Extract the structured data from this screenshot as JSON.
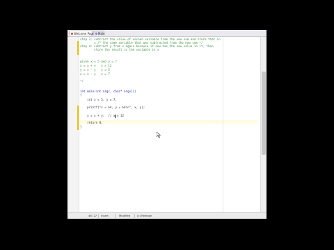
{
  "tabs": [
    {
      "label": "Welcome Page"
    },
    {
      "label": "Main"
    }
  ],
  "code_lines": [
    {
      "text": "step 3: subtract the value of second variable from the new sum and store that in",
      "style": "cmt"
    },
    {
      "text": "        x /* the same variable that was subtracted from the new sum */",
      "style": "cmt"
    },
    {
      "text": "step 4: subtract y from x again because it now has the new value in it, then",
      "style": "cmt"
    },
    {
      "text": "        store the result in the variable in x",
      "style": "cmt"
    },
    {
      "text": "",
      "style": ""
    },
    {
      "text": "",
      "style": ""
    },
    {
      "text": "given x = 5 and y = 7",
      "style": "cmt"
    },
    {
      "text": "x = x + y   x = 12",
      "style": "cmt"
    },
    {
      "text": "y = x - y   y = 5",
      "style": "cmt"
    },
    {
      "text": "x = x - y   x = 7",
      "style": "cmt"
    },
    {
      "text": "",
      "style": ""
    },
    {
      "text": "*/",
      "style": "cmt"
    },
    {
      "text": "",
      "style": ""
    },
    {
      "text": "int main(int argc, char* argv[])",
      "style": "kw"
    },
    {
      "text": "{",
      "style": ""
    },
    {
      "text": "    int x = 5, y = 7;",
      "style": ""
    },
    {
      "text": "",
      "style": ""
    },
    {
      "text": "    printf(\"x = %d, y = %d\\n\", x, y);",
      "style": ""
    },
    {
      "text": "",
      "style": ""
    },
    {
      "text": "    x = x + y;  // x = 12",
      "style": ""
    },
    {
      "text": "",
      "style": ""
    },
    {
      "text": "    return 0;",
      "style": ""
    },
    {
      "text": "}",
      "style": ""
    }
  ],
  "status": {
    "position": "46: 27",
    "insert": "Insert",
    "modified": "Modified",
    "build": "(c) Release"
  }
}
